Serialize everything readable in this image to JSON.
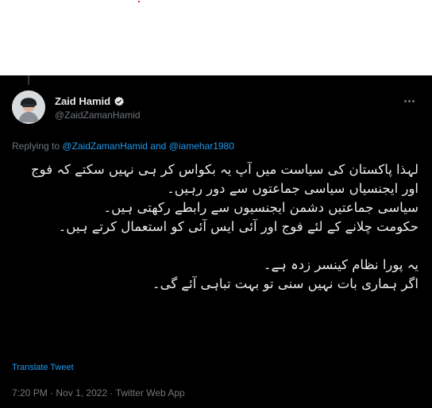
{
  "author": {
    "display_name": "Zaid Hamid",
    "handle": "@ZaidZamanHamid",
    "verified": true
  },
  "replying": {
    "prefix": "Replying to",
    "mention_1": "@ZaidZamanHamid",
    "conjunction": "and",
    "mention_2": "@iamehar1980"
  },
  "tweet": {
    "paragraph_1": "لہذا پاکستان کی سیاست میں آپ یہ بکواس کر ہی نہیں سکتے کہ فوج اور ایجنسیاں سیاسی جماعتوں سے دور رہیں۔",
    "paragraph_2": "سیاسی جماعتیں دشمن ایجنسیوں سے رابطے رکھتی ہیں۔",
    "paragraph_3": "حکومت چلانے کے لئے فوج اور آئی ایس آئی کو استعمال کرتے ہیں۔",
    "paragraph_4": "یہ پورا نظام کینسر زدہ ہے۔",
    "paragraph_5": "اگر ہماری بات نہیں سنی تو بہت تباہی آئے گی۔"
  },
  "translate_label": "Translate Tweet",
  "meta": {
    "time": "7:20 PM",
    "separator": "·",
    "date": "Nov 1, 2022",
    "source": "Twitter Web App"
  },
  "icons": {
    "verified": "verified-badge-icon",
    "more": "more-options-icon"
  },
  "colors": {
    "background": "#000000",
    "text": "#e7e9ea",
    "secondary": "#71767b",
    "link": "#1d9bf0"
  }
}
